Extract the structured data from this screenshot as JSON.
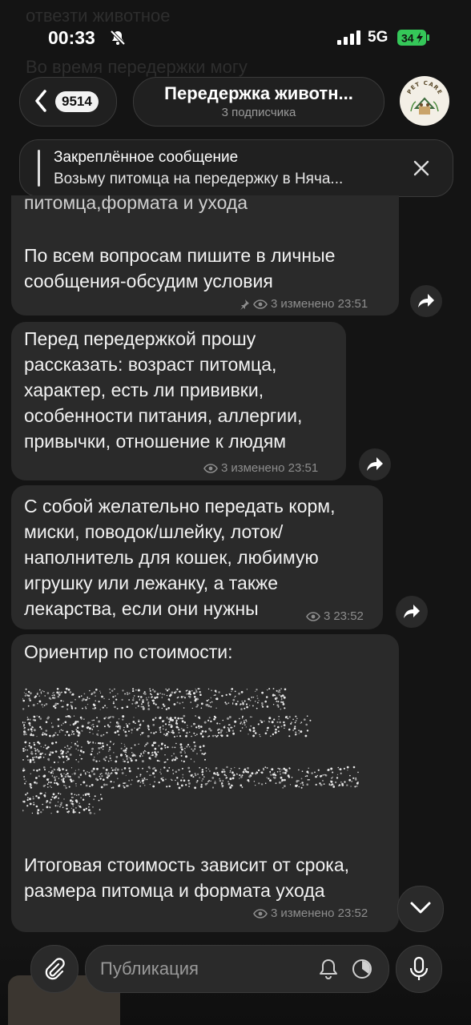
{
  "status_bar": {
    "time": "00:33",
    "network": "5G",
    "battery": "34"
  },
  "ghost_lines": [
    "отвезти животное",
    "Во время передержки могу"
  ],
  "header": {
    "unread_count": "9514",
    "title": "Передержка животн...",
    "subtitle": "3 подписчика",
    "avatar_text": "PET CARE"
  },
  "pinned": {
    "label": "Закреплённое сообщение",
    "text": "Возьму питомца на передержку в Няча..."
  },
  "messages": [
    {
      "partial_top": "питомца,формата и ухода",
      "text": "По всем вопросам пишите в личные\nсообщения-обсудим условия",
      "views": "3",
      "time": "изменено 23:51",
      "pinned": true
    },
    {
      "text": "Перед передержкой прошу\nрассказать: возраст питомца,\nхарактер, есть ли прививки,\nособенности питания, аллергии,\nпривычки, отношение к людям",
      "views": "3",
      "time": "изменено 23:51"
    },
    {
      "text": "С собой желательно передать корм,\nмиски, поводок/шлейку, лоток/\nнаполнитель для кошек, любимую\nигрушку или лежанку, а также\nлекарства, если они нужны",
      "views": "3",
      "time": "23:52"
    },
    {
      "header": "Ориентир по стоимости:",
      "footer": "Итоговая стоимость зависит от срока,\nразмера питомца и формата ухода",
      "views": "3",
      "time": "изменено 23:52"
    }
  ],
  "composer": {
    "placeholder": "Публикация"
  },
  "colors": {
    "background": "#141414",
    "bubble": "#2a2a2a",
    "meta": "#8d8d8d"
  }
}
